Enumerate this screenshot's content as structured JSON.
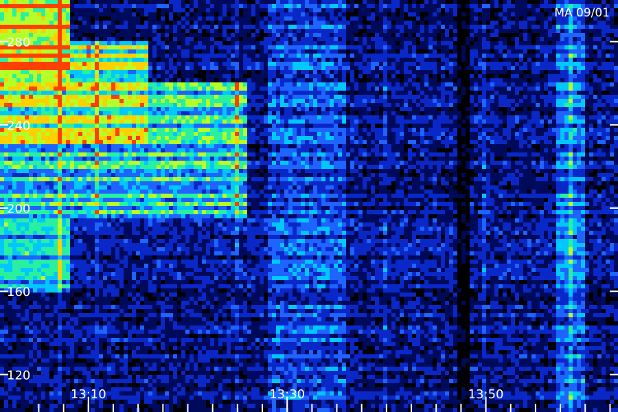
{
  "chart_data": {
    "type": "heatmap",
    "title": "",
    "annotation": "MA 09/01",
    "xlabel": "",
    "ylabel": "",
    "x_range_minutes": [
      1.1,
      63.3
    ],
    "y_range": [
      102,
      300
    ],
    "x_ticks": [
      {
        "value": 10,
        "label": "13:10"
      },
      {
        "value": 30,
        "label": "13:30"
      },
      {
        "value": 50,
        "label": "13:50"
      }
    ],
    "x_minor_tick_step": 2.5,
    "y_ticks": [
      {
        "value": 120,
        "label": "120"
      },
      {
        "value": 160,
        "label": "160"
      },
      {
        "value": 200,
        "label": "200"
      },
      {
        "value": 240,
        "label": "240"
      },
      {
        "value": 280,
        "label": "280"
      }
    ],
    "colormap": [
      "#000000",
      "#000a5a",
      "#0a28c8",
      "#1e64ff",
      "#00c8ff",
      "#28f0a0",
      "#b4ff28",
      "#ffd000",
      "#ff4000"
    ],
    "intensity_regions": [
      {
        "x": [
          1.1,
          8
        ],
        "y": [
          260,
          300
        ],
        "level": 0.95
      },
      {
        "x": [
          1.1,
          16
        ],
        "y": [
          230,
          280
        ],
        "level": 0.7
      },
      {
        "x": [
          1.1,
          26
        ],
        "y": [
          195,
          260
        ],
        "level": 0.55
      },
      {
        "x": [
          1.1,
          8
        ],
        "y": [
          160,
          200
        ],
        "level": 0.5
      },
      {
        "x": [
          28,
          36
        ],
        "y": [
          102,
          300
        ],
        "level": 0.35
      },
      {
        "x": [
          47,
          48.5
        ],
        "y": [
          102,
          300
        ],
        "level": 0.05
      },
      {
        "x": [
          57,
          60
        ],
        "y": [
          102,
          300
        ],
        "level": 0.4
      }
    ]
  }
}
